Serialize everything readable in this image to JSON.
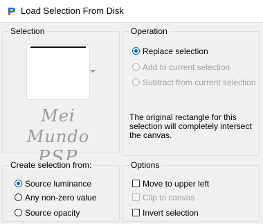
{
  "window": {
    "title": "Load Selection From Disk"
  },
  "selection": {
    "label": "Selection",
    "watermark_line1": "Mei Mundo",
    "watermark_line2": "PSP"
  },
  "operation": {
    "label": "Operation",
    "options": [
      {
        "label": "Replace selection",
        "checked": true,
        "enabled": true
      },
      {
        "label": "Add to current selection",
        "checked": false,
        "enabled": false
      },
      {
        "label": "Subtract from current selection",
        "checked": false,
        "enabled": false
      }
    ],
    "info": "The original rectangle for this selection will completely intersect the canvas."
  },
  "create_from": {
    "label": "Create selection from:",
    "options": [
      {
        "label": "Source luminance",
        "checked": true
      },
      {
        "label": "Any non-zero value",
        "checked": false
      },
      {
        "label": "Source opacity",
        "checked": false
      }
    ]
  },
  "options": {
    "label": "Options",
    "items": [
      {
        "label": "Move to upper left",
        "checked": false,
        "enabled": true
      },
      {
        "label": "Clip to canvas",
        "checked": false,
        "enabled": false
      },
      {
        "label": "Invert selection",
        "checked": false,
        "enabled": true
      }
    ]
  },
  "colors": {
    "accent": "#0067c0",
    "disabled_text": "#a0a0a0",
    "background": "#f0f0f0"
  }
}
